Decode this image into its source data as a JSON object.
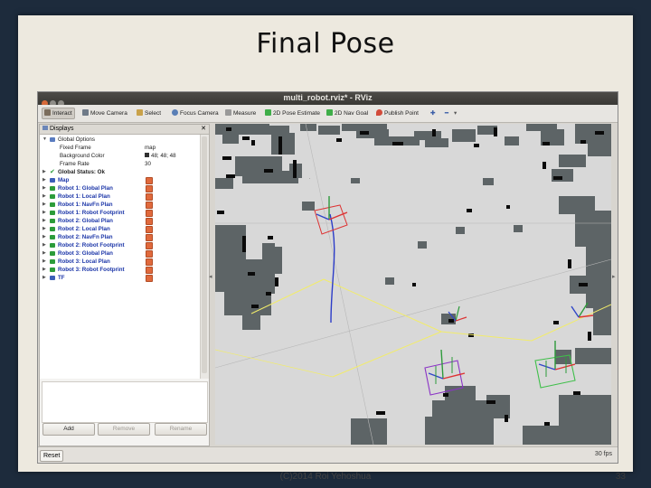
{
  "slide": {
    "title": "Final Pose",
    "footer": "(C)2014 Roi Yehoshua",
    "page_number": "33"
  },
  "window": {
    "title": "multi_robot.rviz* - RViz"
  },
  "toolbar": {
    "items": [
      {
        "label": "Interact",
        "icon": "cursor-hand-icon"
      },
      {
        "label": "Move Camera",
        "icon": "move-camera-icon"
      },
      {
        "label": "Select",
        "icon": "select-icon"
      },
      {
        "label": "Focus Camera",
        "icon": "focus-camera-icon"
      },
      {
        "label": "Measure",
        "icon": "measure-icon"
      },
      {
        "label": "2D Pose Estimate",
        "icon": "pose-estimate-arrow-icon"
      },
      {
        "label": "2D Nav Goal",
        "icon": "nav-goal-arrow-icon"
      },
      {
        "label": "Publish Point",
        "icon": "pin-icon"
      }
    ],
    "extra_icons": [
      "plus-icon",
      "minus-icon",
      "dropdown-icon"
    ]
  },
  "displays": {
    "title": "Displays",
    "global_options": {
      "label": "Global Options",
      "fixed_frame_label": "Fixed Frame",
      "fixed_frame_value": "map",
      "bg_color_label": "Background Color",
      "bg_color_value": "48; 48; 48",
      "frame_rate_label": "Frame Rate",
      "frame_rate_value": "30"
    },
    "global_status": "Global Status: Ok",
    "items": [
      {
        "label": "Map",
        "icon_color": "#3b5fb8"
      },
      {
        "label": "Robot 1: Global Plan",
        "icon_color": "#2c9c3a"
      },
      {
        "label": "Robot 1: Local Plan",
        "icon_color": "#2c9c3a"
      },
      {
        "label": "Robot 1: NavFn Plan",
        "icon_color": "#2c9c3a"
      },
      {
        "label": "Robot 1: Robot Footprint",
        "icon_color": "#2c9c3a"
      },
      {
        "label": "Robot 2: Global Plan",
        "icon_color": "#2c9c3a"
      },
      {
        "label": "Robot 2: Local Plan",
        "icon_color": "#2c9c3a"
      },
      {
        "label": "Robot 2: NavFn Plan",
        "icon_color": "#2c9c3a"
      },
      {
        "label": "Robot 2: Robot Footprint",
        "icon_color": "#2c9c3a"
      },
      {
        "label": "Robot 3: Global Plan",
        "icon_color": "#2c9c3a"
      },
      {
        "label": "Robot 3: Local Plan",
        "icon_color": "#2c9c3a"
      },
      {
        "label": "Robot 3: Robot Footprint",
        "icon_color": "#2c9c3a"
      },
      {
        "label": "TF",
        "icon_color": "#3b5fb8"
      }
    ],
    "buttons": {
      "add": "Add",
      "remove": "Remove",
      "rename": "Rename"
    }
  },
  "status": {
    "reset": "Reset",
    "fps": "30 fps"
  },
  "colors": {
    "map_free": "#d8d8d8",
    "map_unknown": "#5d6466",
    "map_occupied": "#0a0a0a",
    "accent_check": "#e0693c",
    "link_blue": "#1b35a8"
  }
}
